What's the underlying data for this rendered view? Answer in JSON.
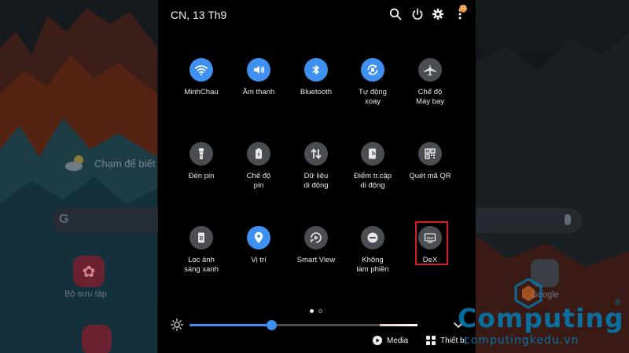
{
  "header": {
    "date": "CN, 13 Th9",
    "notification_count": "12"
  },
  "tiles": [
    {
      "label": "MinhChau",
      "icon": "wifi-icon",
      "state": "on"
    },
    {
      "label": "Âm thanh",
      "icon": "sound-icon",
      "state": "on"
    },
    {
      "label": "Bluetooth",
      "icon": "bluetooth-icon",
      "state": "on"
    },
    {
      "label": "Tự động\nxoay",
      "icon": "auto-rotate-icon",
      "state": "on"
    },
    {
      "label": "Chế độ\nMáy bay",
      "icon": "airplane-icon",
      "state": "off"
    },
    {
      "label": "Đèn pin",
      "icon": "flashlight-icon",
      "state": "off"
    },
    {
      "label": "Chế độ\npin",
      "icon": "battery-mode-icon",
      "state": "off"
    },
    {
      "label": "Dữ liệu\ndi động",
      "icon": "mobile-data-icon",
      "state": "off"
    },
    {
      "label": "Điểm tr.cập\ndi động",
      "icon": "hotspot-icon",
      "state": "off"
    },
    {
      "label": "Quét mã QR",
      "icon": "qr-scan-icon",
      "state": "off"
    },
    {
      "label": "Lọc ánh\nsáng xanh",
      "icon": "blue-light-filter-icon",
      "state": "off"
    },
    {
      "label": "Vị trí",
      "icon": "location-icon",
      "state": "on"
    },
    {
      "label": "Smart View",
      "icon": "smart-view-icon",
      "state": "off"
    },
    {
      "label": "Không\nlàm phiền",
      "icon": "do-not-disturb-icon",
      "state": "off"
    },
    {
      "label": "DeX",
      "icon": "dex-icon",
      "state": "off"
    }
  ],
  "pager": {
    "pages": 2,
    "current": 1
  },
  "brightness": {
    "level": 0.36
  },
  "buttons": {
    "media": "Media",
    "devices": "Thiết bị"
  },
  "background": {
    "weather_text": "Chạm để biết th",
    "google_letter": "G",
    "app_gallery_label": "Bộ sưu tập",
    "app_google_label": "Google"
  },
  "watermark": {
    "brand": "Computing",
    "registered": "®",
    "url": "computingkedu.vn"
  },
  "colors": {
    "accent": "#3e91f0",
    "tile_off": "#4a4e53",
    "highlight_box": "#d42020",
    "watermark": "#0082be"
  }
}
